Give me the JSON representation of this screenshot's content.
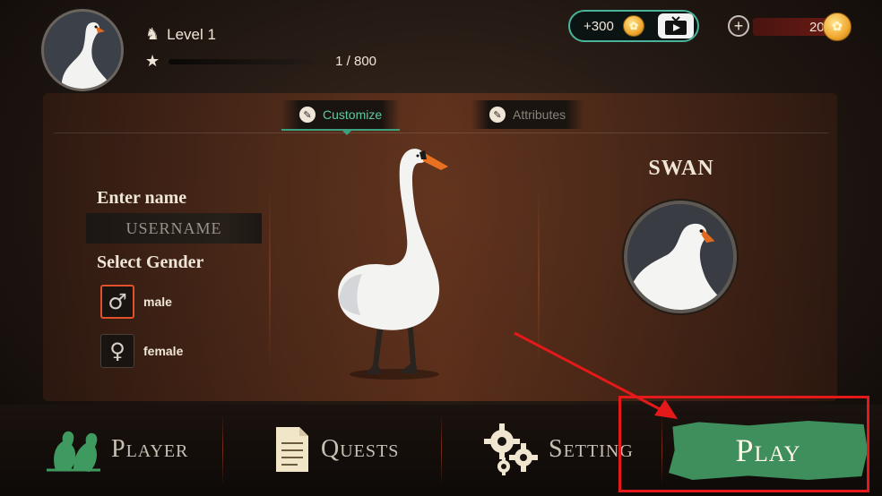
{
  "player": {
    "level_label": "Level 1",
    "xp_text": "1 / 800",
    "xp_progress": 0.00125
  },
  "currency": {
    "reward_amount": "+300",
    "coins": "200",
    "coin_color": "#f0a830",
    "accent_color": "#4ab39a"
  },
  "tabs": [
    {
      "label": "Customize",
      "icon": "brush-icon",
      "active": true
    },
    {
      "label": "Attributes",
      "icon": "brush-icon",
      "active": false
    }
  ],
  "customize": {
    "name_label": "Enter name",
    "name_placeholder": "USERNAME",
    "name_value": "",
    "gender_label": "Select Gender",
    "genders": [
      {
        "label": "male",
        "symbol": "♂",
        "selected": true
      },
      {
        "label": "female",
        "symbol": "♀",
        "selected": false
      }
    ]
  },
  "species": {
    "title": "SWAN"
  },
  "nav": {
    "player": "Player",
    "quests": "Quests",
    "setting": "Setting",
    "play": "Play",
    "play_color": "#3e8f5c",
    "highlight_color": "#e41a1a"
  }
}
